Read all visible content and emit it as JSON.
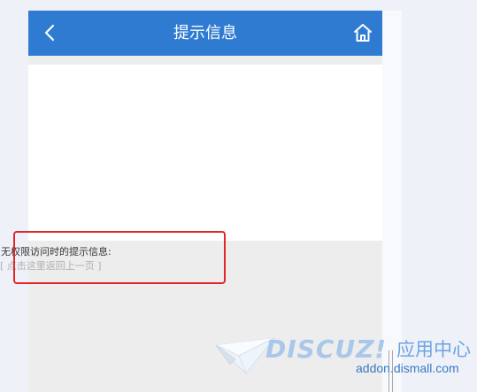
{
  "header": {
    "title": "提示信息",
    "back_icon": "chevron-left-icon",
    "home_icon": "home-icon",
    "background_color": "#2f7bd1"
  },
  "message": {
    "text": "无权限访问时的提示信息:",
    "return_link": "[ 点击这里返回上一页 ]",
    "highlight_color": "#e4262b"
  },
  "watermark": {
    "brand": "DISCUZ!",
    "app_center": "应用中心",
    "url": "addon.dismall.com"
  }
}
